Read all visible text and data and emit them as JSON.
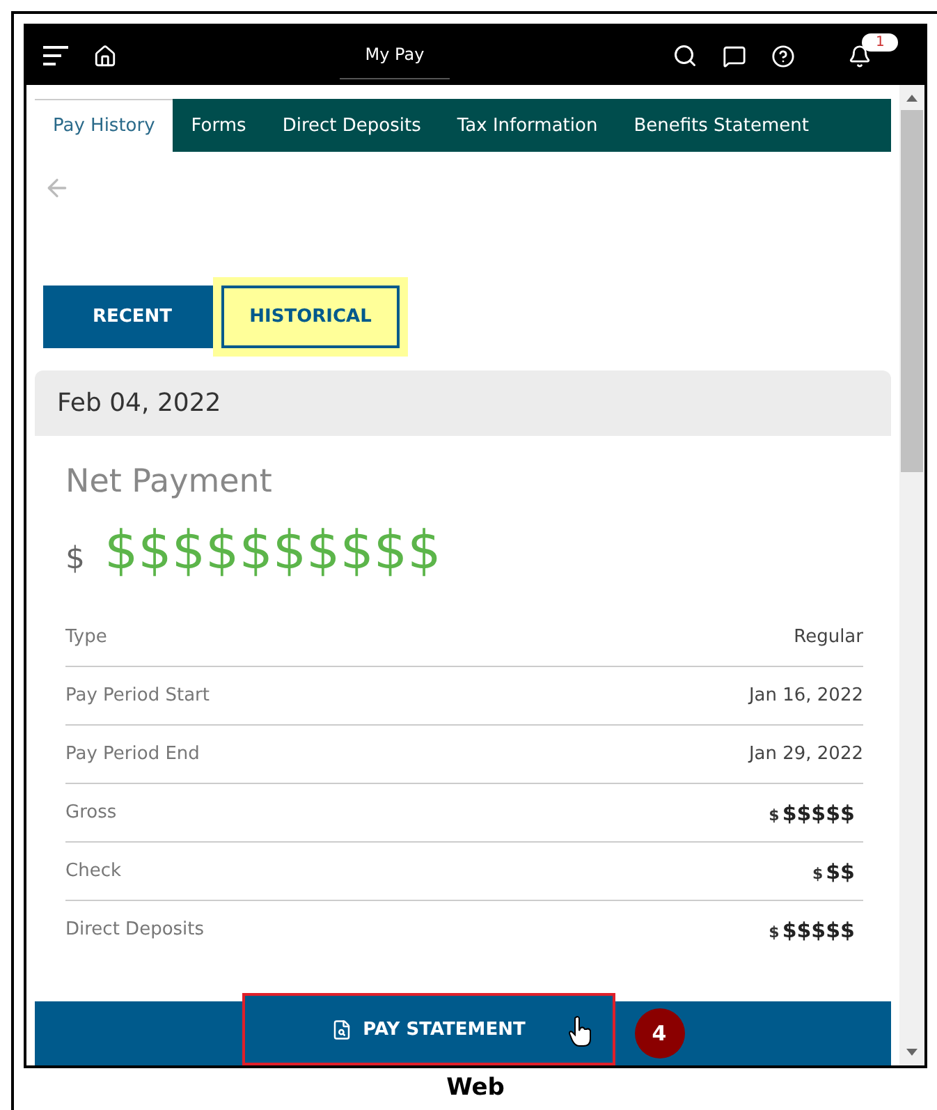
{
  "top_bar": {
    "title": "My Pay",
    "notification_count": "1"
  },
  "tabs": [
    {
      "label": "Pay History",
      "selected": true
    },
    {
      "label": "Forms",
      "selected": false
    },
    {
      "label": "Direct Deposits",
      "selected": false
    },
    {
      "label": "Tax Information",
      "selected": false
    },
    {
      "label": "Benefits Statement",
      "selected": false
    }
  ],
  "toggle": [
    {
      "label": "RECENT",
      "selected": false,
      "highlighted": false
    },
    {
      "label": "HISTORICAL",
      "selected": true,
      "highlighted": true
    }
  ],
  "pay_date": "Feb 04, 2022",
  "net_payment": {
    "label": "Net Payment",
    "currency": "$",
    "amount": "$$$$$$$$$$"
  },
  "details": [
    {
      "label": "Type",
      "value": "Regular"
    },
    {
      "label": "Pay Period Start",
      "value": "Jan 16, 2022"
    },
    {
      "label": "Pay Period End",
      "value": "Jan 29, 2022"
    },
    {
      "label": "Gross",
      "currency": "$",
      "value": "$$$$$"
    },
    {
      "label": "Check",
      "currency": "$",
      "value": "$$"
    },
    {
      "label": "Direct Deposits",
      "currency": "$",
      "value": "$$$$$"
    }
  ],
  "pay_statement_button": {
    "label": "PAY STATEMENT",
    "highlighted": true,
    "step": "4"
  },
  "caption": "Web"
}
